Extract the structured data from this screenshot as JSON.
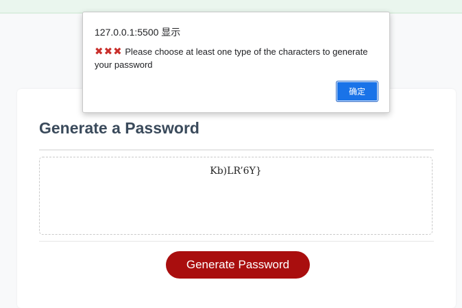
{
  "dialog": {
    "origin": "127.0.0.1:5500 显示",
    "icons": [
      "cross-mark-icon",
      "cross-mark-icon",
      "cross-mark-icon"
    ],
    "icon_glyph": "✖✖✖",
    "message": "Please choose at least one type of the characters to generate your password",
    "ok_label": "确定"
  },
  "card": {
    "title": "Generate a Password",
    "password_value": "Kb)LR’6Y}",
    "generate_label": "Generate Password"
  },
  "colors": {
    "button_red": "#a90e0e",
    "dialog_button_blue": "#1a73e8",
    "cross_red": "#c9302c",
    "title_text": "#3a4a5b"
  }
}
